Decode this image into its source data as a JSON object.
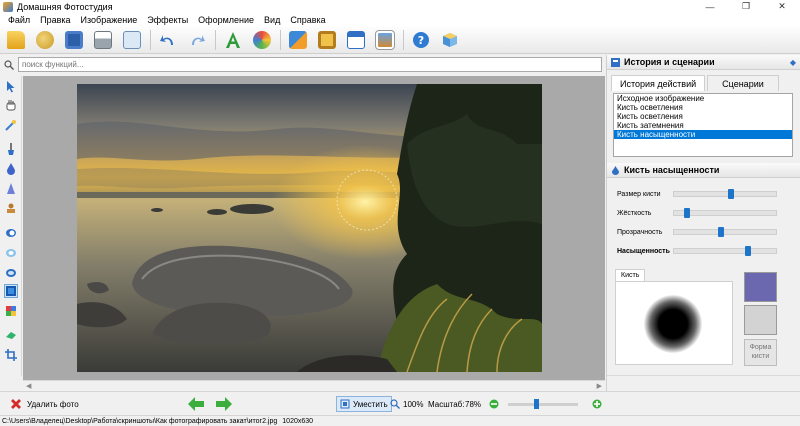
{
  "window": {
    "title": "Домашняя Фотостудия",
    "controls": [
      "—",
      "❐",
      "✕"
    ]
  },
  "menu": [
    "Файл",
    "Правка",
    "Изображение",
    "Эффекты",
    "Оформление",
    "Вид",
    "Справка"
  ],
  "toolbar": {
    "icons": [
      "open-folder-icon",
      "palette-icon",
      "save-icon",
      "print-icon",
      "preview-icon",
      "undo-icon",
      "redo-icon",
      "text-tool-icon",
      "decor-icon",
      "effects-icon",
      "frame-icon",
      "calendar-icon",
      "collage-icon",
      "help-icon",
      "3d-box-icon"
    ]
  },
  "search": {
    "placeholder": "поиск функций..."
  },
  "history_panel": {
    "title": "История и сценарии",
    "tabs": [
      "История действий",
      "Сценарии"
    ],
    "items": [
      "Исходное изображение",
      "Кисть осветления",
      "Кисть осветления",
      "Кисть затемнения",
      "Кисть насыщенности"
    ],
    "selected_index": 4
  },
  "brush_panel": {
    "title": "Кисть насыщенности",
    "sliders": [
      {
        "label": "Размер кисти",
        "value": 0.55
      },
      {
        "label": "Жёсткость",
        "value": 0.1
      },
      {
        "label": "Прозрачность",
        "value": 0.45
      },
      {
        "label": "Насыщенность",
        "value": 0.72
      }
    ],
    "brush_tab": "Кисть",
    "color_main": "#6b68b0",
    "color_secondary": "#d3d3d3",
    "shape_button": [
      "Форма",
      "кисти"
    ]
  },
  "bottom": {
    "delete_label": "Удалить фото",
    "fit_label": "Уместить",
    "zoom100_label": "100%",
    "scale_label": "Масштаб:",
    "scale_value": "78%",
    "zoom_slider": 0.4
  },
  "status": {
    "path": "C:\\Users\\Владелец\\Desktop\\Работа\\скриншоты\\Как фотографировать закат\\итог2.jpg",
    "dimensions": "1020x630"
  }
}
